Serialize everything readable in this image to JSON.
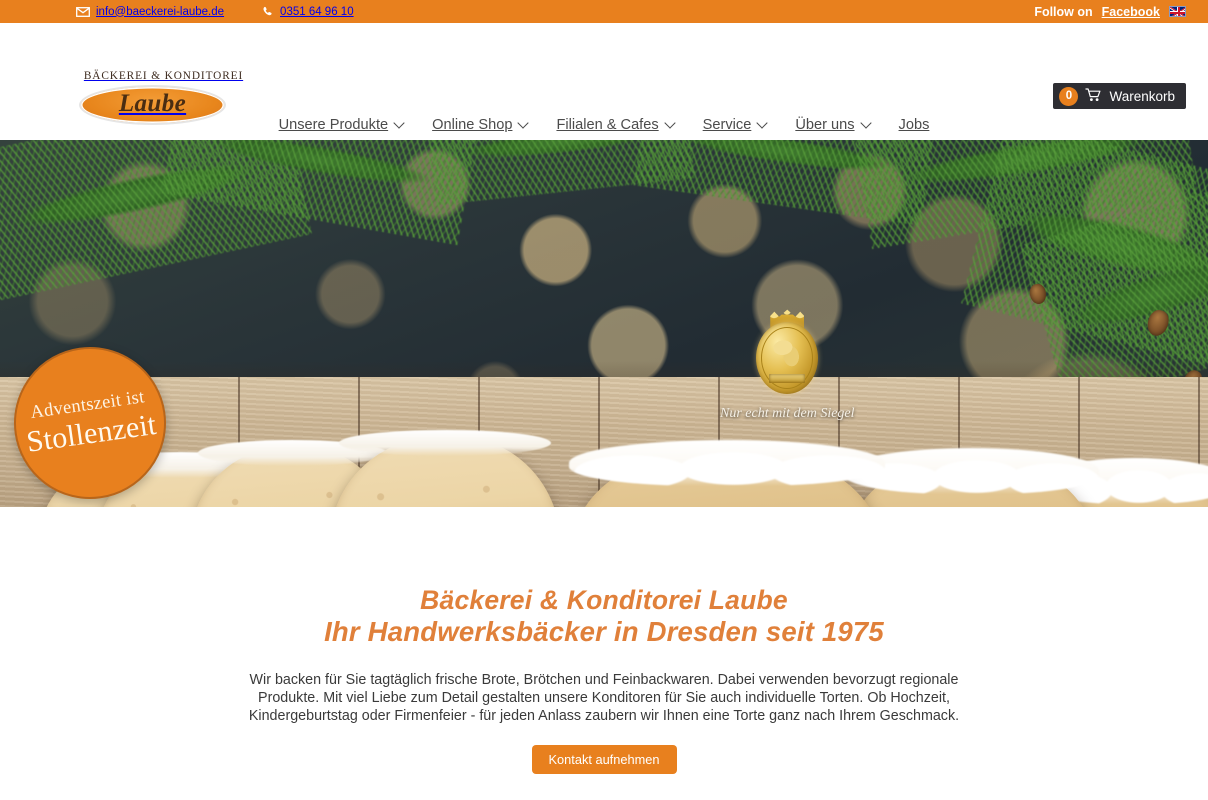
{
  "topbar": {
    "email": "info@baeckerei-laube.de",
    "email_icon": "envelope-icon",
    "phone": "0351 64 96 10",
    "phone_icon": "phone-icon",
    "follow_prefix": "Follow on",
    "facebook_label": "Facebook",
    "language_icon": "uk-flag-icon",
    "bg_color": "#e8801e"
  },
  "header": {
    "logo": {
      "top_text": "BÄCKEREI & KONDITOREI",
      "word": "Laube"
    },
    "cart": {
      "count": "0",
      "icon": "shopping-cart-icon",
      "label": "Warenkorb"
    },
    "nav": [
      {
        "label": "Unsere Produkte",
        "has_dropdown": true
      },
      {
        "label": "Online Shop",
        "has_dropdown": true
      },
      {
        "label": "Filialen & Cafes",
        "has_dropdown": true
      },
      {
        "label": "Service",
        "has_dropdown": true
      },
      {
        "label": "Über uns",
        "has_dropdown": true
      },
      {
        "label": "Jobs",
        "has_dropdown": false
      }
    ]
  },
  "hero": {
    "badge": {
      "line1": "Adventszeit ist",
      "line2": "Stollenzeit",
      "color": "#e8801e"
    },
    "seal": {
      "icon": "dresdner-stollen-seal-icon",
      "caption": "Nur echt mit dem Siegel"
    }
  },
  "content": {
    "headline_line1": "Bäckerei & Konditorei Laube",
    "headline_line2": "Ihr Handwerksbäcker in Dresden seit 1975",
    "headline_color": "#e0803a",
    "paragraph": "Wir backen für Sie tagtäglich frische Brote, Brötchen und Feinbackwaren. Dabei verwenden bevorzugt regionale Produkte. Mit viel Liebe zum Detail gestalten unsere Konditoren für Sie auch individuelle Torten. Ob Hochzeit, Kindergeburtstag oder Firmenfeier - für jeden Anlass zaubern wir Ihnen eine Torte ganz nach Ihrem Geschmack.",
    "cta_label": "Kontakt aufnehmen"
  }
}
